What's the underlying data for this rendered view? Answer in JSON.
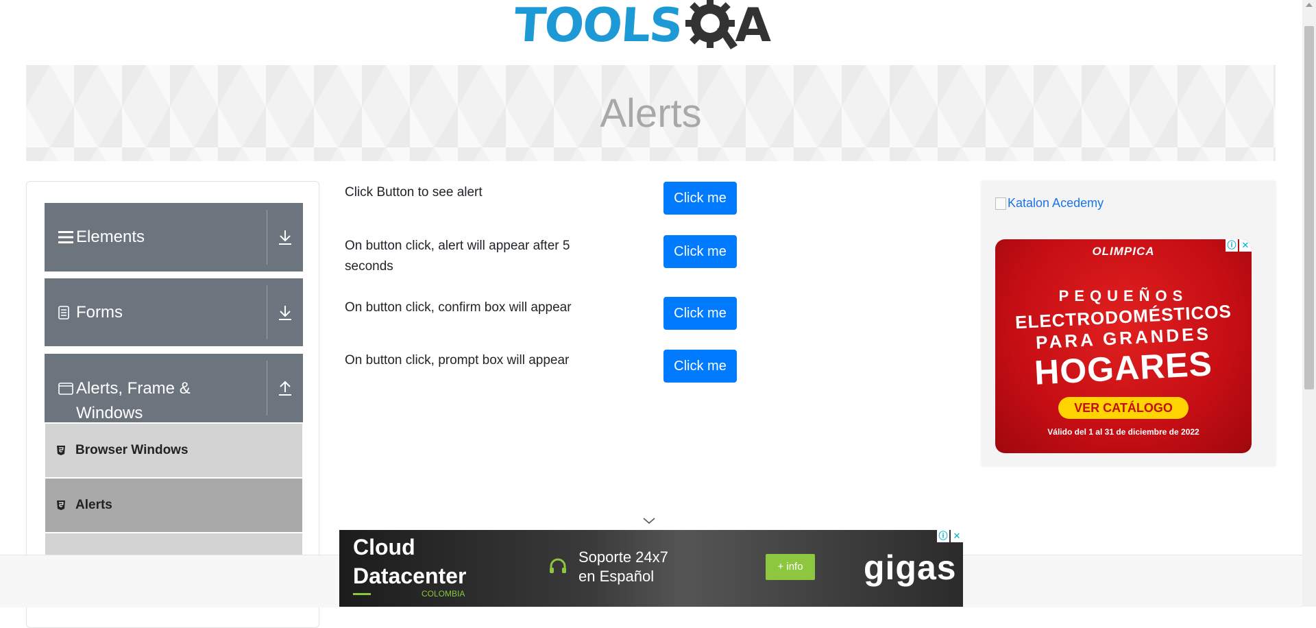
{
  "logo": {
    "text_left": "TOOLS",
    "text_right": "A"
  },
  "banner": {
    "title": "Alerts"
  },
  "sidebar": {
    "groups": [
      {
        "label": "Elements"
      },
      {
        "label": "Forms"
      },
      {
        "label": "Alerts, Frame & Windows"
      }
    ],
    "items": [
      {
        "label": "Browser Windows"
      },
      {
        "label": "Alerts"
      }
    ]
  },
  "main": {
    "rows": [
      {
        "text": "Click Button to see alert",
        "button": "Click me"
      },
      {
        "text": "On button click, alert will appear after 5 seconds",
        "button": "Click me"
      },
      {
        "text": "On button click, confirm box will appear",
        "button": "Click me"
      },
      {
        "text": "On button click, prompt box will appear",
        "button": "Click me"
      }
    ]
  },
  "right_ad": {
    "image_alt": "Katalon Acedemy",
    "brand": "OLIMPICA",
    "line1": "PEQUEÑOS",
    "line2": "ELECTRODOMÉSTICOS",
    "line3": "PARA GRANDES",
    "line4": "HOGARES",
    "cta": "VER CATÁLOGO",
    "validity": "Válido del 1 al 31 de diciembre de 2022"
  },
  "bottom_ad": {
    "line1": "Cloud",
    "line2": "Datacenter",
    "country": "COLOMBIA",
    "support1": "Soporte 24x7",
    "support2": "en Español",
    "info": "+ info",
    "brand": "gigas"
  },
  "colors": {
    "accent": "#007bff",
    "sidebar_group": "#6c757d",
    "sub_item": "#d3d3d3",
    "sub_item_active": "#a9a9a9"
  }
}
